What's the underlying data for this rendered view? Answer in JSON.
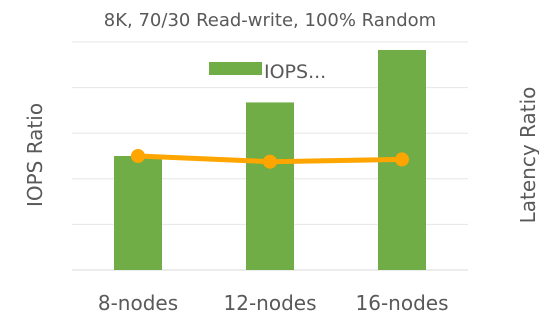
{
  "chart_data": {
    "type": "bar",
    "title": "8K, 70/30 Read-write, 100% Random",
    "ylabel": "IOPS Ratio",
    "y2label": "Latency  Ratio",
    "categories": [
      "8-nodes",
      "12-nodes",
      "16-nodes"
    ],
    "ylim": [
      0,
      2
    ],
    "y2lim": [
      0,
      2
    ],
    "grid": true,
    "legend_position": "top",
    "series": [
      {
        "name": "IOPS...",
        "type": "bar",
        "axis": "left",
        "color": "#70ad47",
        "values": [
          1.0,
          1.47,
          1.93
        ]
      },
      {
        "type": "line",
        "axis": "right",
        "color": "#ffa500",
        "values": [
          1.0,
          0.95,
          0.97
        ]
      }
    ]
  }
}
